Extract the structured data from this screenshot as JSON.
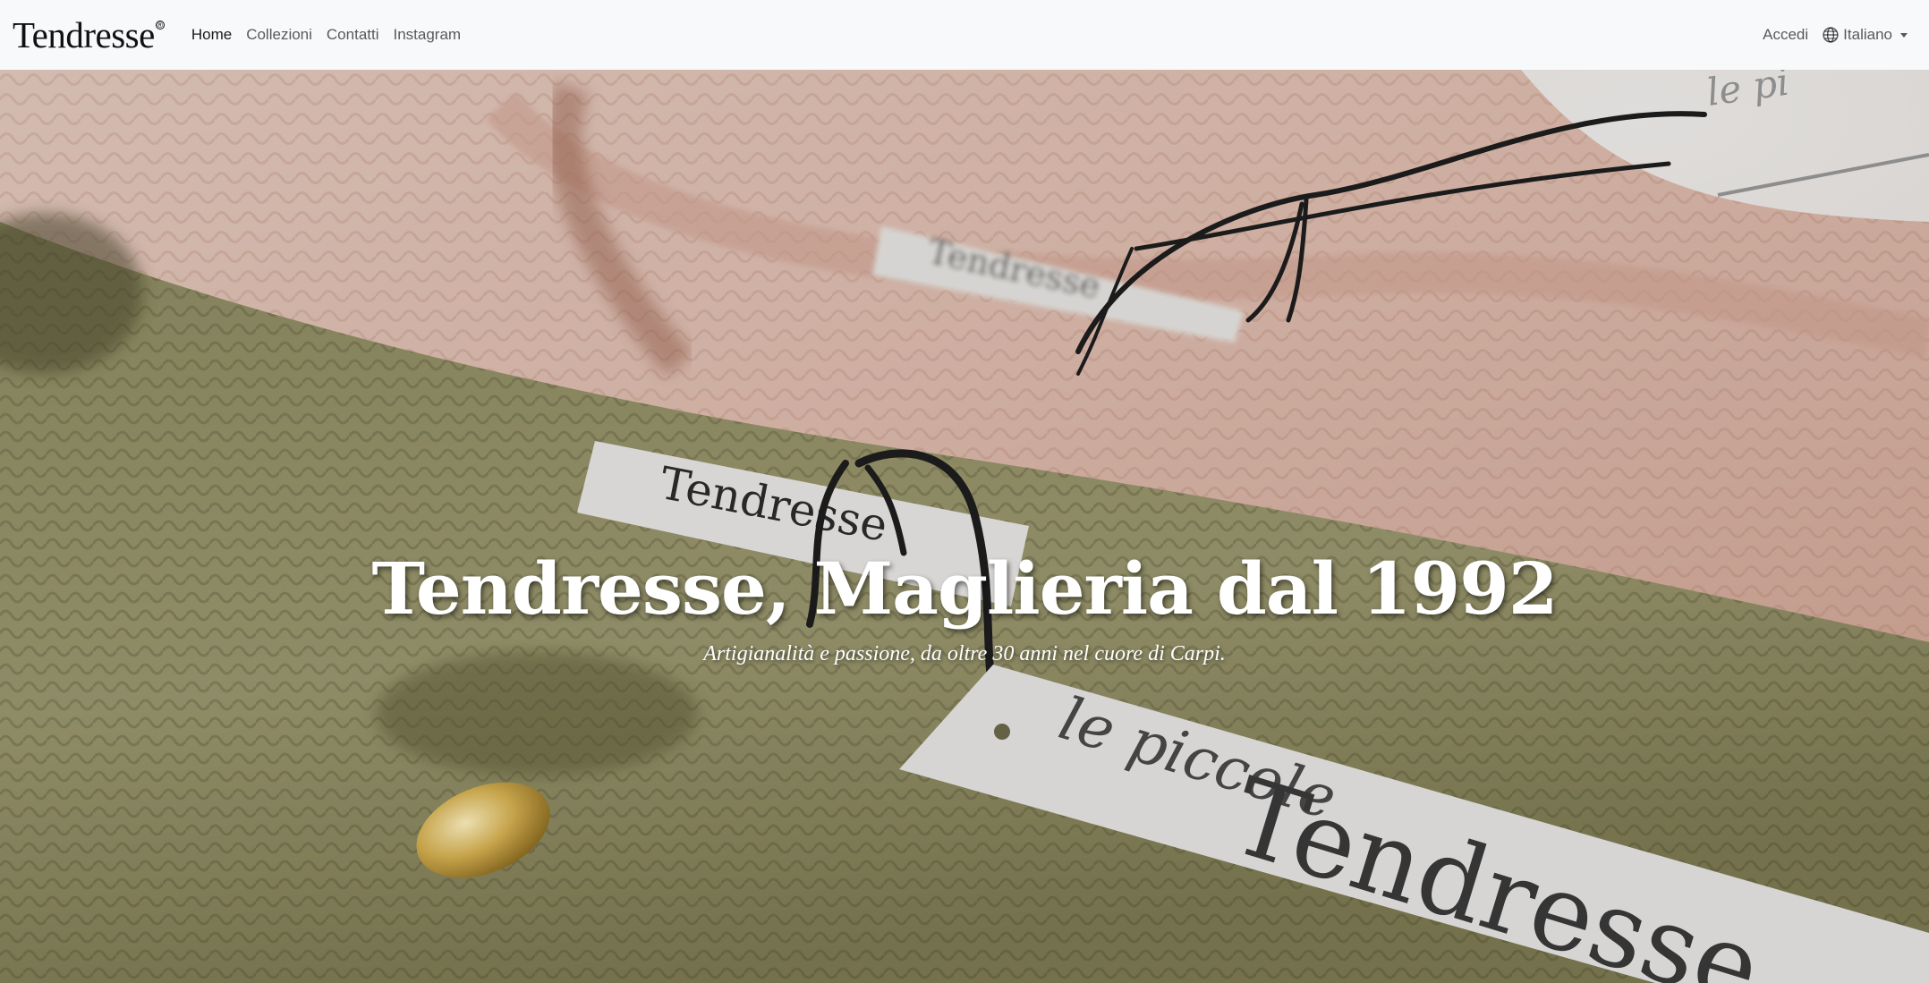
{
  "brand": {
    "name": "Tendresse",
    "mark": "®"
  },
  "nav": {
    "items": [
      {
        "label": "Home",
        "active": true
      },
      {
        "label": "Collezioni",
        "active": false
      },
      {
        "label": "Contatti",
        "active": false
      },
      {
        "label": "Instagram",
        "active": false
      }
    ],
    "login_label": "Accedi",
    "language": {
      "selected": "Italiano",
      "icon": "globe-icon"
    }
  },
  "hero": {
    "title": "Tendresse, Maglieria dal 1992",
    "subtitle": "Artigianalità e passione, da oltre 30 anni nel cuore di Carpi.",
    "image": {
      "tag_small_1": "Tendresse",
      "tag_small_2": "Tendresse",
      "tag_large_script": "le piccole",
      "tag_large_brand": "Tendresse",
      "tag_corner_script": "le pi"
    }
  },
  "colors": {
    "navbar_bg": "#f8f9fa",
    "pink_knit": "#dcb9ac",
    "green_knit": "#8d8a5f",
    "label_white": "#e6e4e1",
    "string": "#1e1e1e",
    "button_gold": "#c8a64a"
  }
}
